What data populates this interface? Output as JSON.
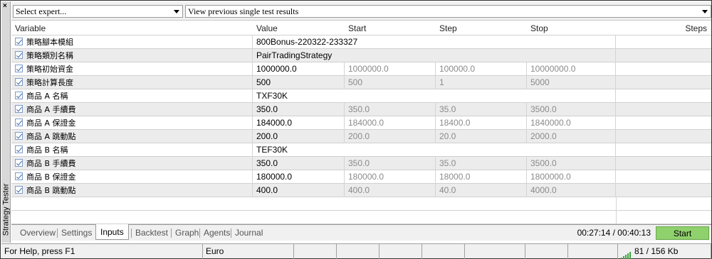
{
  "panel": {
    "close_glyph": "×",
    "title": "Strategy Tester"
  },
  "selectors": {
    "expert": "Select expert...",
    "results": "View previous single test results"
  },
  "table": {
    "headers": {
      "variable": "Variable",
      "value": "Value",
      "start": "Start",
      "step": "Step",
      "stop": "Stop",
      "steps": "Steps"
    },
    "rows": [
      {
        "name": "策略腳本模組",
        "value": "800Bonus-220322-233327",
        "start": "",
        "step": "",
        "stop": "",
        "checked": true
      },
      {
        "name": "策略類別名稱",
        "value": "PairTradingStrategy",
        "start": "",
        "step": "",
        "stop": "",
        "checked": true
      },
      {
        "name": "策略初始資金",
        "value": "1000000.0",
        "start": "1000000.0",
        "step": "100000.0",
        "stop": "10000000.0",
        "checked": true
      },
      {
        "name": "策略計算長度",
        "value": "500",
        "start": "500",
        "step": "1",
        "stop": "5000",
        "checked": true
      },
      {
        "name": "商品 A 名稱",
        "value": "TXF30K",
        "start": "",
        "step": "",
        "stop": "",
        "checked": true
      },
      {
        "name": "商品 A 手續費",
        "value": "350.0",
        "start": "350.0",
        "step": "35.0",
        "stop": "3500.0",
        "checked": true
      },
      {
        "name": "商品 A 保證金",
        "value": "184000.0",
        "start": "184000.0",
        "step": "18400.0",
        "stop": "1840000.0",
        "checked": true
      },
      {
        "name": "商品 A 跳動點",
        "value": "200.0",
        "start": "200.0",
        "step": "20.0",
        "stop": "2000.0",
        "checked": true
      },
      {
        "name": "商品 B 名稱",
        "value": "TEF30K",
        "start": "",
        "step": "",
        "stop": "",
        "checked": true
      },
      {
        "name": "商品 B 手續費",
        "value": "350.0",
        "start": "350.0",
        "step": "35.0",
        "stop": "3500.0",
        "checked": true
      },
      {
        "name": "商品 B 保證金",
        "value": "180000.0",
        "start": "180000.0",
        "step": "18000.0",
        "stop": "1800000.0",
        "checked": true
      },
      {
        "name": "商品 B 跳動點",
        "value": "400.0",
        "start": "400.0",
        "step": "40.0",
        "stop": "4000.0",
        "checked": true
      }
    ]
  },
  "tabs": {
    "items": [
      "Overview",
      "Settings",
      "Inputs",
      "Backtest",
      "Graph",
      "Agents",
      "Journal"
    ],
    "active": "Inputs",
    "timer": "00:27:14 / 00:40:13",
    "start_label": "Start"
  },
  "status": {
    "help": "For Help, press F1",
    "symbol": "Euro",
    "traffic": "81 / 156 Kb",
    "traffic_color": "#3ea53e"
  }
}
